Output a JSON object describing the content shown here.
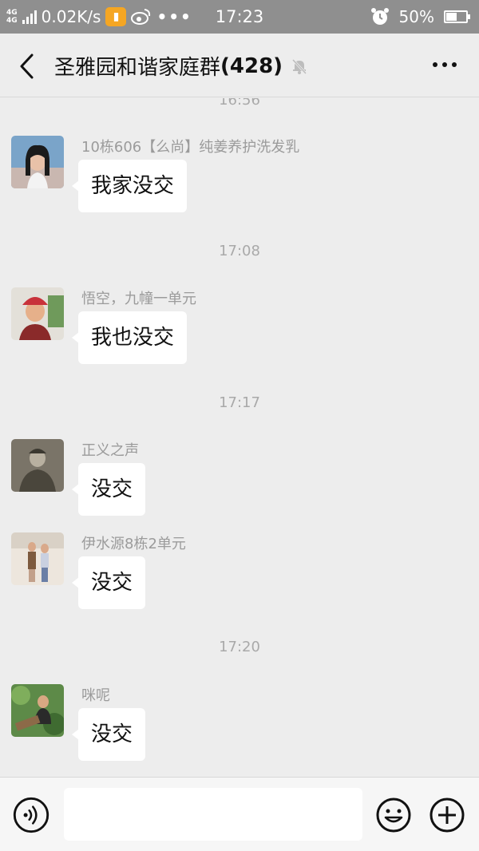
{
  "status_bar": {
    "network_top": "4G",
    "network_bottom": "4G",
    "speed": "0.02K/s",
    "time": "17:23",
    "battery_text": "50%",
    "battery_level": 0.5
  },
  "header": {
    "title": "圣雅园和谐家庭群",
    "member_count": "(428)"
  },
  "messages": [
    {
      "type": "timestamp",
      "text": "16:56"
    },
    {
      "type": "message",
      "sender": "10栋606【么尚】纯姜养护洗发乳",
      "text": "我家没交"
    },
    {
      "type": "timestamp",
      "text": "17:08"
    },
    {
      "type": "message",
      "sender": "悟空，九幢一单元",
      "text": "我也没交"
    },
    {
      "type": "timestamp",
      "text": "17:17"
    },
    {
      "type": "message",
      "sender": "正义之声",
      "text": "没交"
    },
    {
      "type": "message",
      "sender": "伊水源8栋2单元",
      "text": "没交"
    },
    {
      "type": "timestamp",
      "text": "17:20"
    },
    {
      "type": "message",
      "sender": "咪呢",
      "text": "没交"
    }
  ],
  "input_bar": {
    "value": "",
    "placeholder": ""
  },
  "icons": {
    "back": "chevron-left-icon",
    "mute": "bell-muted-icon",
    "more": "more-dots-icon",
    "voice": "voice-icon",
    "emoji": "emoji-icon",
    "plus": "plus-icon"
  }
}
